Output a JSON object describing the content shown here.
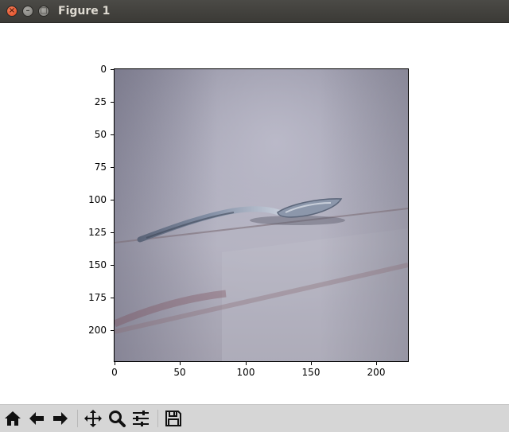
{
  "window": {
    "title": "Figure 1",
    "close_glyph": "×",
    "min_glyph": "–",
    "max_glyph": "□"
  },
  "figure": {
    "image_description_icon": "photo-of-spoon-on-white-surface",
    "y_ticks": [
      "0",
      "25",
      "50",
      "75",
      "100",
      "125",
      "150",
      "175",
      "200"
    ],
    "y_tick_values": [
      0,
      25,
      50,
      75,
      100,
      125,
      150,
      175,
      200
    ],
    "x_ticks": [
      "0",
      "50",
      "100",
      "150",
      "200"
    ],
    "x_tick_values": [
      0,
      50,
      100,
      150,
      200
    ],
    "x_range": [
      0,
      224
    ],
    "y_range": [
      0,
      224
    ]
  },
  "toolbar": {
    "home_icon": "home-icon",
    "back_icon": "back-arrow-icon",
    "forward_icon": "forward-arrow-icon",
    "pan_icon": "pan-move-icon",
    "zoom_icon": "zoom-magnifier-icon",
    "configure_icon": "subplots-sliders-icon",
    "save_icon": "save-floppy-icon"
  }
}
